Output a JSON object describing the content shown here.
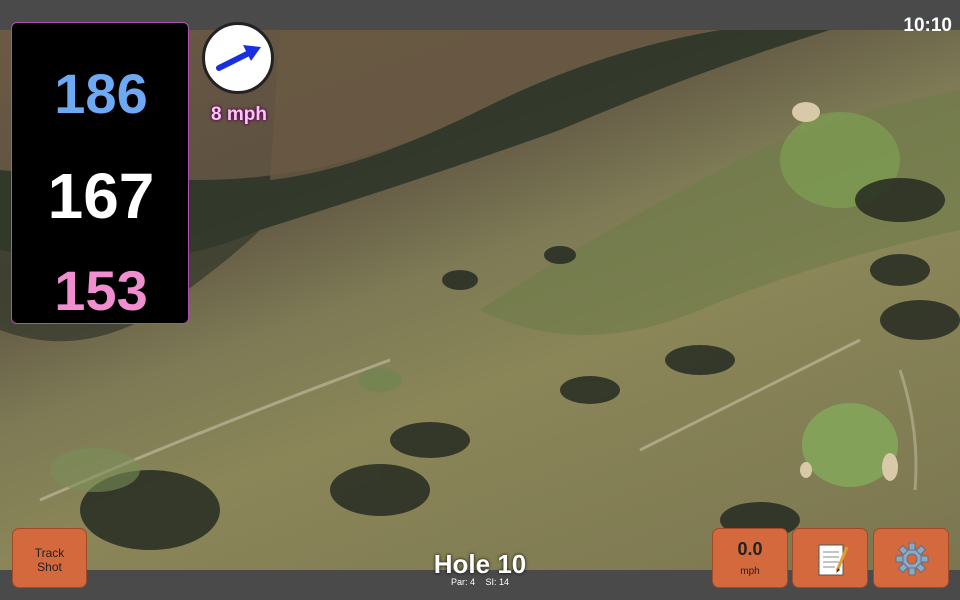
{
  "status": {
    "clock": "10:10"
  },
  "distances": {
    "back": "186",
    "middle": "167",
    "front": "153"
  },
  "wind": {
    "speed_label": "8 mph",
    "icon": "arrow-icon"
  },
  "hole": {
    "title": "Hole 10",
    "par_label": "Par: 4",
    "si_label": "SI: 14"
  },
  "buttons": {
    "track_shot_line1": "Track",
    "track_shot_line2": "Shot",
    "speed_value": "0.0",
    "speed_unit": "mph",
    "notes_icon": "notepad-icon",
    "settings_icon": "gear-icon"
  },
  "colors": {
    "accent": "#d4693e",
    "back_distance": "#6eaaf4",
    "middle_distance": "#ffffff",
    "front_distance": "#f08ed0",
    "wind_arrow": "#1a2ee0"
  }
}
